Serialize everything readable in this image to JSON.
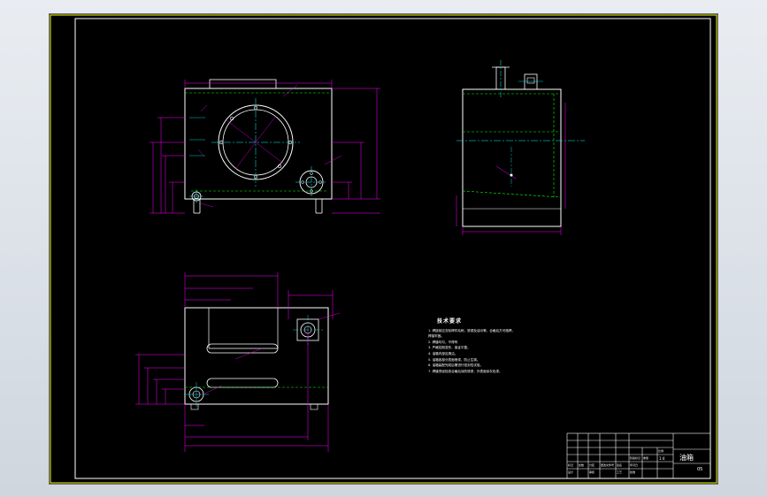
{
  "technical_requirements": {
    "title": "技术要求",
    "lines": [
      "1. 焊接前应去除焊件毛刺、铁锈及油污等，合格后方可施焊，",
      "    焊接牢固。",
      "2. 焊缝均匀，不得有",
      "3. 严格控制变形，保证平整。",
      "4. 油箱内部应清洁。",
      "5. 油箱各部分表面喷漆，防止生锈。",
      "6. 油箱装配完成后需进行密封性试验。",
      "7. 焊缝须经检查合格后涂防锈漆，外表面涂灰色漆。"
    ]
  },
  "title_block": {
    "drawing_name": "油箱",
    "scale": "1:4",
    "sheet_code": "05",
    "revision_cells": [
      "标记",
      "处数",
      "分区",
      "更改文件号",
      "签名",
      "年月日"
    ],
    "approval_cells": [
      "设计",
      "审核",
      "工艺",
      "批准"
    ],
    "stage_cells": [
      "阶段标记",
      "重量",
      "比例"
    ]
  },
  "colors": {
    "background": "#000000",
    "frame": "#ffffff",
    "outline": "#ffffff",
    "dimension": "#ff00ff",
    "centerline": "#00ffff",
    "hidden": "#00ff00",
    "accent": "#ffff00"
  }
}
